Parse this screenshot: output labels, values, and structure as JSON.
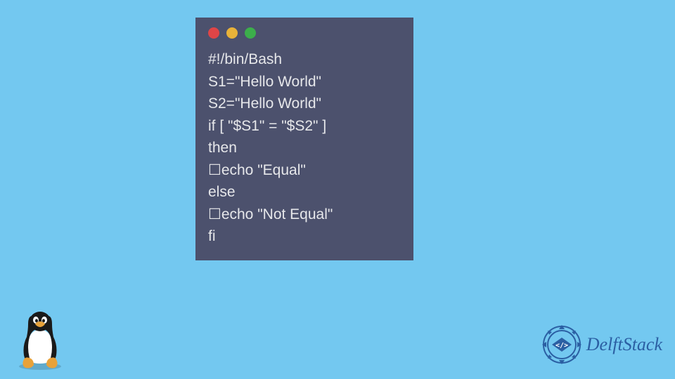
{
  "code": {
    "line1": "#!/bin/Bash",
    "line2": "S1=\"Hello World\"",
    "line3": "S2=\"Hello World\"",
    "line4": "if [ \"$S1\" = \"$S2\" ]",
    "line5": "then",
    "line6": "☐echo \"Equal\"",
    "line7": "else",
    "line8": "☐echo \"Not Equal\"",
    "line9": "fi"
  },
  "brand": {
    "name": "DelftStack"
  },
  "colors": {
    "background": "#73c8f0",
    "window": "#4c516d",
    "code_text": "#e6e7ea",
    "brand_blue": "#2b5fa3",
    "dot_red": "#df4547",
    "dot_yellow": "#e8b239",
    "dot_green": "#3cae4b"
  }
}
